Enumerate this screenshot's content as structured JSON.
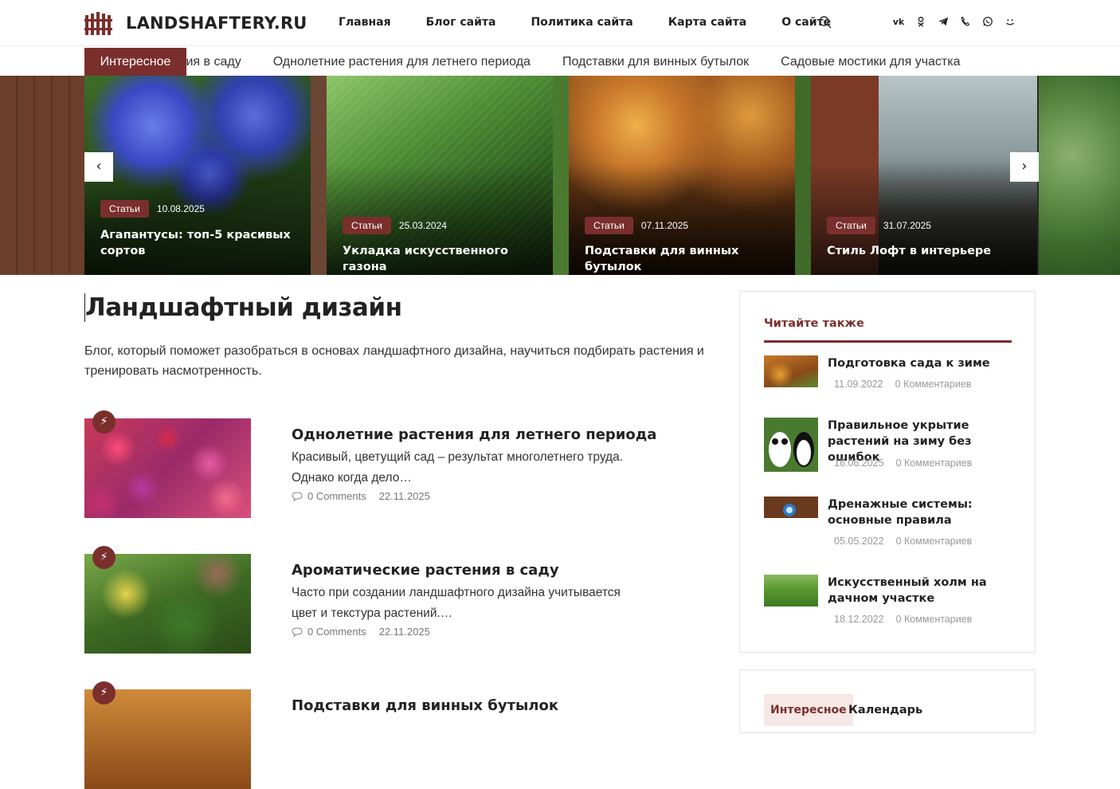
{
  "site": {
    "name": "LANDSHAFTERY.RU"
  },
  "nav": [
    "Главная",
    "Блог сайта",
    "Политика сайта",
    "Карта сайта",
    "О сайте"
  ],
  "socials": [
    "vk-icon",
    "odnoklassniki-icon",
    "telegram-icon",
    "viber-icon",
    "whatsapp-icon",
    "moi-mir-icon"
  ],
  "ticker": {
    "label": "Интересное",
    "items": [
      "Ароматические растения в саду",
      "Однолетние растения для летнего периода",
      "Подставки для винных бутылок",
      "Садовые мостики для участка"
    ]
  },
  "slider": {
    "prev": "‹",
    "next": "›",
    "slides": [
      {
        "badge": "Статьи",
        "date": "10.08.2025",
        "title": "Агапантусы: топ-5 красивых сортов"
      },
      {
        "badge": "Статьи",
        "date": "25.03.2024",
        "title": "Укладка искусственного газона"
      },
      {
        "badge": "Статьи",
        "date": "07.11.2025",
        "title": "Подставки для винных бутылок"
      },
      {
        "badge": "Статьи",
        "date": "31.07.2025",
        "title": "Стиль Лофт в интерьере"
      }
    ]
  },
  "main": {
    "title": "Ландшафтный дизайн",
    "intro": "Блог, который поможет разобраться в основах ландшафтного дизайна, научиться подбирать растения и тренировать насмотренность.",
    "posts": [
      {
        "title": "Однолетние растения для летнего периода",
        "excerpt": "Красивый, цветущий сад – результат многолетнего труда. Однако когда дело…",
        "comments": "0 Comments",
        "date": "22.11.2025"
      },
      {
        "title": "Ароматические растения в саду",
        "excerpt": "Часто при создании ландшафтного дизайна учитывается цвет и текстура растений.…",
        "comments": "0 Comments",
        "date": "22.11.2025"
      },
      {
        "title": "Подставки для винных бутылок",
        "excerpt": "",
        "comments": "",
        "date": ""
      }
    ]
  },
  "sidebar": {
    "title": "Читайте также",
    "items": [
      {
        "title": "Подготовка сада к зиме",
        "date": "11.09.2022",
        "comments": "0 Комментариев"
      },
      {
        "title": "Правильное укрытие растений на зиму без ошибок",
        "date": "16.06.2025",
        "comments": "0 Комментариев"
      },
      {
        "title": "Дренажные системы: основные правила",
        "date": "05.05.2022",
        "comments": "0 Комментариев"
      },
      {
        "title": "Искусственный холм на дачном участке",
        "date": "18.12.2022",
        "comments": "0 Комментариев"
      }
    ],
    "widget2": {
      "label": "Интересное",
      "text": "Календарь"
    }
  }
}
